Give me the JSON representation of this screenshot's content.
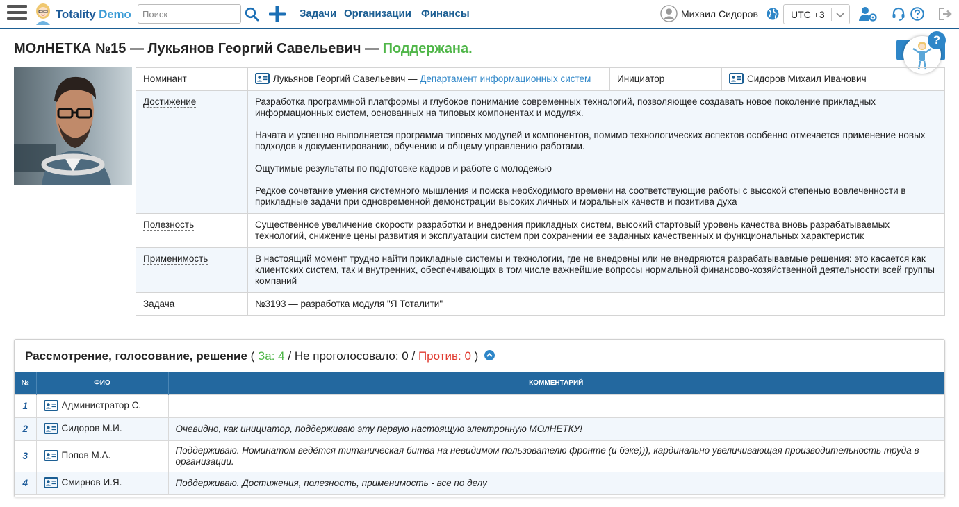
{
  "header": {
    "brand_part1": "Totality",
    "brand_part2": "Demo",
    "search_placeholder": "Поиск",
    "nav": [
      "Задачи",
      "Организации",
      "Финансы"
    ],
    "user_name": "Михаил Сидоров",
    "timezone": "UTC +3",
    "icons": [
      "menu-icon",
      "assistant-logo-icon",
      "search-icon",
      "plus-icon",
      "user-avatar-icon",
      "globe-icon",
      "chevron-down-icon",
      "user-settings-icon",
      "headset-icon",
      "help-icon",
      "logout-icon"
    ],
    "accent_color": "#1b5e93"
  },
  "page": {
    "title_main": "МОлНЕТКА №15 —  Лукьянов Георгий Савельевич — ",
    "title_status": "Поддержана.",
    "status_color": "#4fb648"
  },
  "info": {
    "nominee_label": "Номинант",
    "nominee_name": "Лукьянов Георгий Савельевич — ",
    "nominee_dept": "Департамент информационных систем",
    "initiator_label": "Инициатор",
    "initiator_name": "Сидоров Михаил Иванович",
    "achievement_label": "Достижение",
    "achievement_paragraphs": [
      "Разработка программной платформы и глубокое понимание современных технологий, позволяющее создавать новое поколение прикладных информационных систем, основанных на типовых компонентах и модулях.",
      "Начата и успешно выполняется программа типовых модулей и компонентов, помимо технологических аспектов особенно отмечается применение новых подходов к документированию, обучению и общему управлению работами.",
      "Ощутимые результаты по подготовке кадров и работе с молодежью",
      "Редкое сочетание умения системного мышления и поиска необходимого времени на соответствующие работы с высокой степенью вовлеченности в прикладные задачи при одновременной демонстрации высоких личных и моральных качеств и позитива духа"
    ],
    "usefulness_label": "Полезность",
    "usefulness_text": "Существенное увеличение скорости разработки и внедрения прикладных систем, высокий стартовый уровень качества вновь разрабатываемых технологий, снижение цены развития и эксплуатации систем при сохранении ее заданных качественных и функциональных характеристик",
    "applicability_label": "Применимость",
    "applicability_text": "В настоящий момент трудно найти прикладные системы и технологии, где не внедрены или не внедряются разрабатываемые решения: это касается как клиентских систем, так и внутренних, обеспечивающих в том числе важнейшие вопросы нормальной финансово-хозяйственной деятельности всей группы компаний",
    "task_label": "Задача",
    "task_text": "№3193 — разработка модуля \"Я Тоталити\""
  },
  "voting": {
    "title": "Рассмотрение, голосование, решение",
    "open_paren": " ( ",
    "for_label": "За: 4",
    "sep1": " / ",
    "abstain_label": "Не проголосовало: 0",
    "sep2": " / ",
    "against_label": "Против: 0",
    "close_paren": " )",
    "columns": [
      "№",
      "ФИО",
      "Комментарий"
    ],
    "rows": [
      {
        "num": "1",
        "name": "Администратор С.",
        "comment": ""
      },
      {
        "num": "2",
        "name": "Сидоров М.И.",
        "comment": "Очевидно, как инициатор, поддерживаю эту первую настоящую электронную МОлНЕТКУ!"
      },
      {
        "num": "3",
        "name": "Попов М.А.",
        "comment": "Поддерживаю. Номинатом ведётся титаническая битва на невидимом пользователю фронте (и бэке))), кардинально увеличивающая производительность труда в организации."
      },
      {
        "num": "4",
        "name": "Смирнов И.Я.",
        "comment": "Поддерживаю. Достижения, полезность, применимость - все по делу"
      }
    ],
    "header_color": "#23689f",
    "for_color": "#4fb648",
    "against_color": "#e03c31"
  }
}
